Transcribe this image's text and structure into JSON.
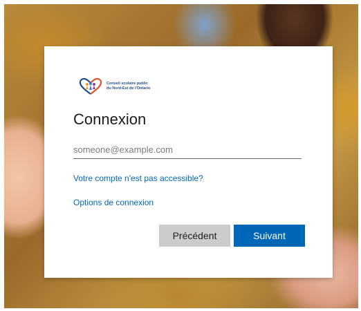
{
  "colors": {
    "accent": "#0067b8",
    "secondary_button": "#cccccc"
  },
  "logo": {
    "icon": "heart-family-logo-icon",
    "line1": "Conseil scolaire public",
    "line2": "du Nord-Est de l'Ontario"
  },
  "signin": {
    "title": "Connexion",
    "email_placeholder": "someone@example.com",
    "email_value": "",
    "cant_access_link": "Votre compte n'est pas accessible?",
    "signin_options_link": "Options de connexion",
    "back_label": "Précédent",
    "next_label": "Suivant"
  }
}
